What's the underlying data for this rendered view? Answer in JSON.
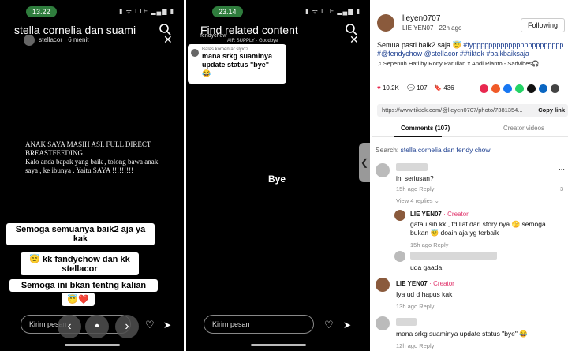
{
  "panel1": {
    "status_time": "13.22",
    "status_icons": "▮ ᯤ LTE ▂▄▆ ▮",
    "search_text": "stella cornelia dan suami",
    "username": "stellacor",
    "posted": "6 menit",
    "story_text": "ANAK SAYA MASIH ASI. FULL DIRECT BREASTFEEDING.\nKalo anda bapak yang baik , tolong bawa anak saya , ke ibunya . Yaitu SAYA !!!!!!!!!",
    "caption_1": "Semoga semuanya baik2 aja ya kak",
    "caption_2": "😇 kk fandychow dan kk stellacor",
    "caption_3": "Semoga ini bkan tentng kalian",
    "caption_4": "😇❤️",
    "message_placeholder": "Kirim pesan",
    "nav_prev": "‹",
    "nav_dot": "•",
    "nav_next": "›"
  },
  "panel2": {
    "status_time": "23.14",
    "status_icons": "▮ ᯤ LTE ▂▄▆ ▮",
    "search_text": "Find related content",
    "username_partial": "fendychow",
    "music_partial": "AIR SUPPLY · Goodbye",
    "reply_header": "Balas komentar slyio?",
    "reply_body": "mana srkg suaminya update status \"bye\"",
    "reply_emoji": "😂",
    "bye_text": "Bye",
    "message_placeholder": "Kirim pesan",
    "side_tab": "❮"
  },
  "panel3": {
    "username": "lieyen0707",
    "subline": "LIE YEN07 · 22h ago",
    "follow_label": "Following",
    "caption_prefix": "Semua pasti baik2 saja 😇",
    "caption_tags": "#fyppppppppppppppppppppppp #@fendychow @stellacor ##tiktok #baikbaiksaja",
    "music": "♫  Sepenuh Hati by Rony Parulian x Andi Rianto - Sadvibes🎧",
    "likes": "10.2K",
    "comments_count": "107",
    "saves": "436",
    "link_url": "https://www.tiktok.com/@lieyen0707/photo/7381354...",
    "copy_link": "Copy link",
    "tab_comments": "Comments (107)",
    "tab_creator_videos": "Creator videos",
    "search_label": "Search:",
    "search_query": "stella cornelia dan fendy chow",
    "comment1_text": "ini seriusan?",
    "comment1_meta": "15h ago     Reply",
    "view_replies": "View 4 replies ⌄",
    "creator_name": "LIE YEN07",
    "creator_tag": "· Creator",
    "reply1_text": "gatau sih kk,, td liat dari story nya 🫣 semoga bukan 😇 doain aja yg terbaik",
    "reply1_meta": "15h ago     Reply",
    "comment3_text": "uda gaada",
    "creator2_text": "Iya ud d hapus kak",
    "creator2_meta": "13h ago     Reply",
    "comment4_text": "mana srkg suaminya update status \"bye\" 😂",
    "comment4_meta": "12h ago     Reply",
    "side_count": "3"
  },
  "colors": {
    "status_green": "#2f7d3d",
    "creator_pink": "#e0336b",
    "hashtag_blue": "#1a3d8f",
    "heart_red": "#e8284f"
  }
}
